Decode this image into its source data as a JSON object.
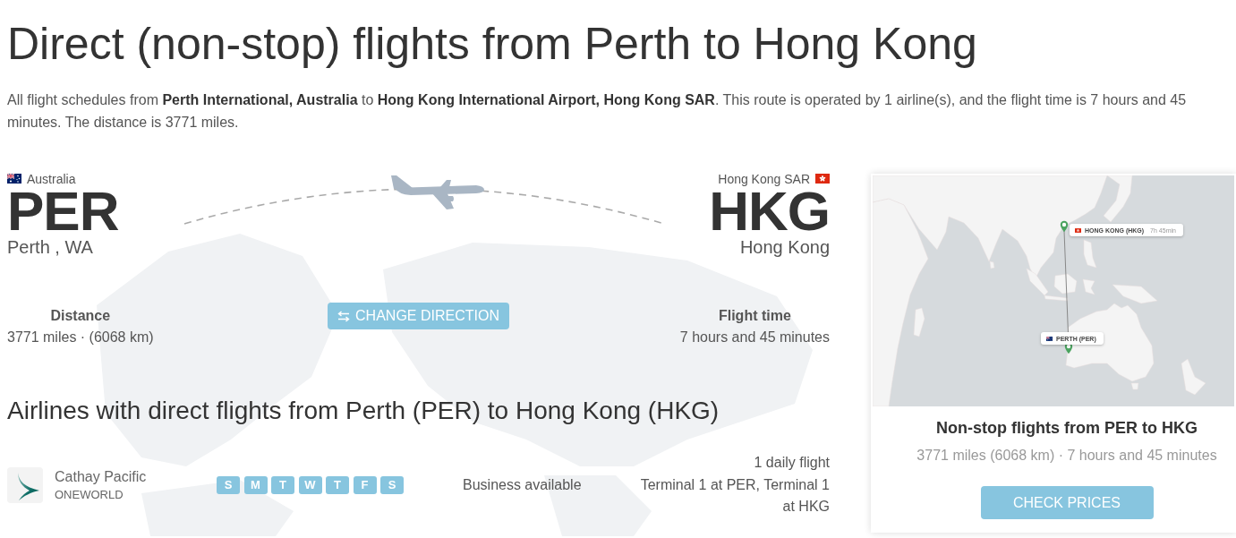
{
  "page": {
    "title": "Direct (non-stop) flights from Perth to Hong Kong",
    "intro": "All flight schedules from **Perth International, Australia** to **Hong Kong International Airport, Hong Kong SAR**. This route is operated by 1 airline(s), and the flight time is 7 hours and 45 minutes. The distance is 3771 miles."
  },
  "route": {
    "origin": {
      "country": "Australia",
      "code": "PER",
      "city": "Perth , WA"
    },
    "destination": {
      "country": "Hong Kong SAR",
      "code": "HKG",
      "city": "Hong Kong"
    }
  },
  "stats": [
    {
      "label": "Distance",
      "value": "3771 miles · (6068 km)"
    },
    {
      "label": "Flight time",
      "value": "7 hours and 45 minutes"
    }
  ],
  "change_direction": {
    "label": "CHANGE DIRECTION"
  },
  "airlines": {
    "heading": "Airlines with direct flights from Perth (PER) to Hong Kong (HKG)",
    "rows": [
      {
        "name": "Cathay Pacific",
        "alliance": "ONEWORLD",
        "days": [
          {
            "label": "S",
            "active": true
          },
          {
            "label": "M",
            "active": true
          },
          {
            "label": "T",
            "active": true
          },
          {
            "label": "W",
            "active": true
          },
          {
            "label": "T",
            "active": true
          },
          {
            "label": "F",
            "active": true
          },
          {
            "label": "S",
            "active": true
          }
        ],
        "cabin": "Business available",
        "frequency": "1 daily flight",
        "terminals": "Terminal 1 at PER, Terminal 1 at HKG"
      }
    ]
  },
  "summary_card": {
    "map": {
      "labels": [
        {
          "kind": "destination",
          "name": "HONG KONG (HKG)",
          "duration": "7h 45min"
        },
        {
          "kind": "origin",
          "name": "PERTH (PER)"
        }
      ]
    },
    "title": "Non-stop flights from PER to HKG",
    "subtitle": "3771 miles (6068 km) · 7 hours and 45 minutes",
    "button": "CHECK PRICES"
  }
}
